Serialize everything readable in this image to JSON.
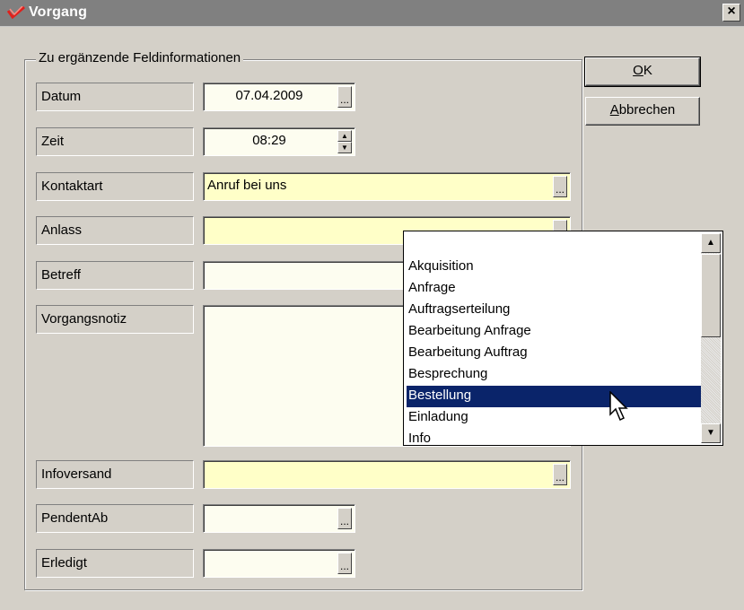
{
  "window": {
    "title": "Vorgang",
    "close_glyph": "×",
    "app_icon": "check-icon"
  },
  "group": {
    "legend": "Zu ergänzende Feldinformationen"
  },
  "fields": {
    "datum": {
      "label": "Datum",
      "value": "07.04.2009",
      "button": "..."
    },
    "zeit": {
      "label": "Zeit",
      "value": "08:29"
    },
    "kontaktart": {
      "label": "Kontaktart",
      "value": "Anruf bei uns",
      "button": "..."
    },
    "anlass": {
      "label": "Anlass",
      "value": "",
      "button": "..."
    },
    "betreff": {
      "label": "Betreff",
      "value": ""
    },
    "vorgangsnotiz": {
      "label": "Vorgangsnotiz",
      "value": ""
    },
    "infoversand": {
      "label": "Infoversand",
      "value": "",
      "button": "..."
    },
    "pendentab": {
      "label": "PendentAb",
      "value": "",
      "button": "..."
    },
    "erledigt": {
      "label": "Erledigt",
      "value": "",
      "button": "..."
    }
  },
  "buttons": {
    "ok": {
      "accel": "O",
      "rest": "K"
    },
    "cancel": {
      "accel": "A",
      "rest": "bbrechen"
    }
  },
  "dropdown": {
    "items": [
      "Akquisition",
      "Anfrage",
      "Auftragserteilung",
      "Bearbeitung Anfrage",
      "Bearbeitung Auftrag",
      "Besprechung",
      "Bestellung",
      "Einladung",
      "Info"
    ],
    "selected": "Bestellung",
    "scroll_up_glyph": "▲",
    "scroll_down_glyph": "▼"
  },
  "colors": {
    "selection": "#0a246a",
    "field_highlight": "#ffffc8",
    "titlebar": "#808080"
  }
}
